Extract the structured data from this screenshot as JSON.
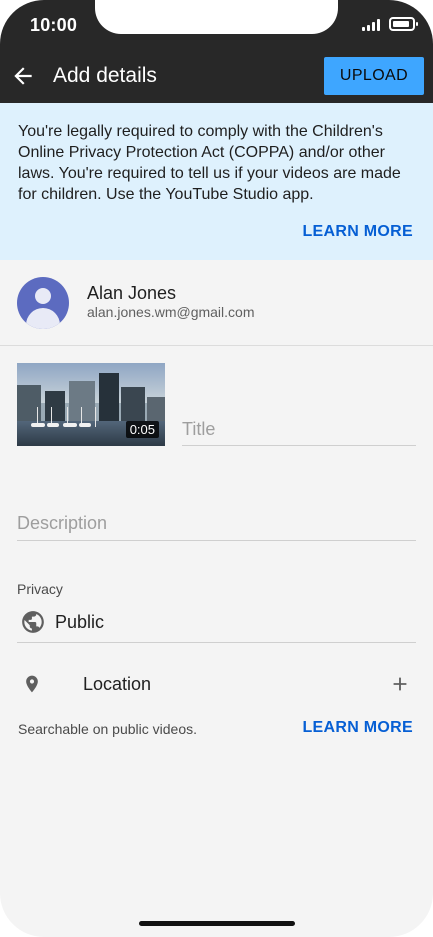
{
  "status_bar": {
    "time": "10:00"
  },
  "app_bar": {
    "title": "Add details",
    "upload_label": "UPLOAD"
  },
  "notice": {
    "text": "You're legally required to comply with the Children's Online Privacy Protection Act (COPPA) and/or other laws. You're required to tell us if your videos are made for children. Use the YouTube Studio app.",
    "learn_more": "LEARN MORE"
  },
  "account": {
    "name": "Alan Jones",
    "email": "alan.jones.wm@gmail.com"
  },
  "video": {
    "duration": "0:05",
    "title_placeholder": "Title",
    "description_placeholder": "Description"
  },
  "privacy": {
    "label": "Privacy",
    "value": "Public"
  },
  "location": {
    "label": "Location",
    "hint": "Searchable on public videos.",
    "learn_more": "LEARN MORE"
  },
  "colors": {
    "accent": "#3ea6ff",
    "link": "#065fd4",
    "banner": "#def1fd",
    "app_bar": "#282828"
  }
}
